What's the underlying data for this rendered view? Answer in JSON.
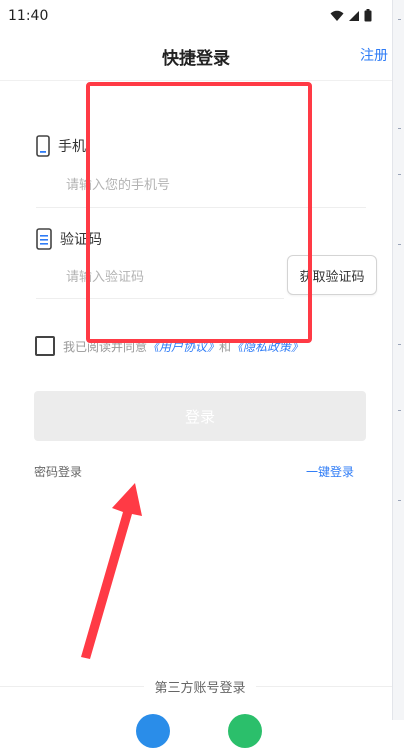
{
  "status_bar": {
    "time": "11:40"
  },
  "header": {
    "title": "快捷登录",
    "register_label": "注册"
  },
  "phone": {
    "label": "手机",
    "placeholder": "请输入您的手机号"
  },
  "code": {
    "label": "验证码",
    "placeholder": "请输入验证码",
    "button_label": "获取验证码"
  },
  "agreement": {
    "prefix": "我已阅读并同意",
    "user_agreement": "《用户协议》",
    "and": "和",
    "privacy_policy": "《隐私政策》"
  },
  "login_button": "登录",
  "password_login": "密码登录",
  "one_key_login": "一键登录",
  "third_party": {
    "label": "第三方账号登录"
  },
  "colors": {
    "accent": "#2f7cf6",
    "annotation": "#ff3a45"
  }
}
